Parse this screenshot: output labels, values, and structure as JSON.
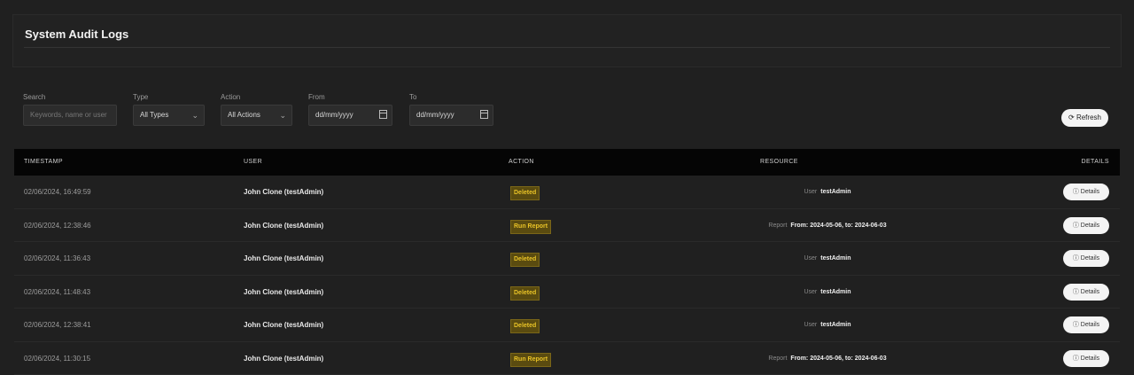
{
  "page": {
    "title": "System Audit Logs"
  },
  "filters": {
    "search": {
      "label": "Search",
      "placeholder": "Keywords, name or user"
    },
    "type": {
      "label": "Type",
      "value": "All Types"
    },
    "action": {
      "label": "Action",
      "value": "All Actions"
    },
    "from": {
      "label": "From",
      "value": "dd/mm/yyyy"
    },
    "to": {
      "label": "To",
      "value": "dd/mm/yyyy"
    },
    "refresh_label": "Refresh"
  },
  "table": {
    "columns": [
      "TIMESTAMP",
      "USER",
      "ACTION",
      "RESOURCE",
      "DETAILS"
    ],
    "rows": [
      {
        "timestamp": "02/06/2024, 16:49:59",
        "user": "John Clone (testAdmin)",
        "action": "Deleted",
        "resource_label": "User",
        "resource_value": "testAdmin",
        "details": "Details"
      },
      {
        "timestamp": "02/06/2024, 12:38:46",
        "user": "John Clone (testAdmin)",
        "action": "Run Report",
        "resource_label": "Report",
        "resource_value": "From: 2024-05-06, to: 2024-06-03",
        "details": "Details"
      },
      {
        "timestamp": "02/06/2024, 11:36:43",
        "user": "John Clone (testAdmin)",
        "action": "Deleted",
        "resource_label": "User",
        "resource_value": "testAdmin",
        "details": "Details"
      },
      {
        "timestamp": "02/06/2024, 11:48:43",
        "user": "John Clone (testAdmin)",
        "action": "Deleted",
        "resource_label": "User",
        "resource_value": "testAdmin",
        "details": "Details"
      },
      {
        "timestamp": "02/06/2024, 12:38:41",
        "user": "John Clone (testAdmin)",
        "action": "Deleted",
        "resource_label": "User",
        "resource_value": "testAdmin",
        "details": "Details"
      },
      {
        "timestamp": "02/06/2024, 11:30:15",
        "user": "John Clone (testAdmin)",
        "action": "Run Report",
        "resource_label": "Report",
        "resource_value": "From: 2024-05-06, to: 2024-06-03",
        "details": "Details"
      }
    ]
  },
  "icons": {
    "refresh": "refresh-icon",
    "details": "info-icon",
    "calendar": "calendar-icon",
    "dropdown": "chevron-down-icon"
  },
  "colors": {
    "background": "#202020",
    "header_row": "#050505",
    "badge_text": "#e8c227",
    "badge_bg": "#5a4b10",
    "button_bg": "#f4f4f4"
  }
}
